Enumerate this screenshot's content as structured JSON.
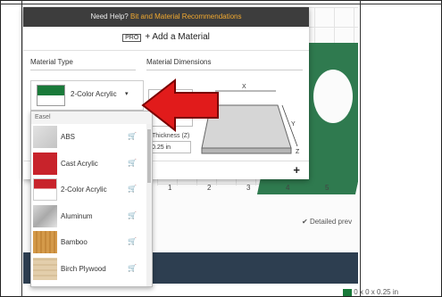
{
  "help_bar": {
    "prefix": "Need Help?",
    "link": "Bit and Material Recommendations"
  },
  "modal": {
    "pro_badge": "PRO",
    "title": "+ Add a Material",
    "material_type_label": "Material Type",
    "material_dimensions_label": "Material Dimensions",
    "selected_material": "2-Color Acrylic",
    "thickness_label": "Thickness (Z)",
    "thickness_value": "0.25 in",
    "diagram_x": "X",
    "diagram_y": "Y",
    "diagram_z": "Z",
    "add_icon": "+"
  },
  "dropdown": {
    "group_header": "Easel",
    "items": [
      {
        "label": "ABS",
        "color": "#d4d4d4"
      },
      {
        "label": "Cast Acrylic",
        "color": "#c8232b"
      },
      {
        "label": "2-Color Acrylic",
        "color": "#c8232b"
      },
      {
        "label": "Aluminum",
        "color": "#c9c9c9"
      },
      {
        "label": "Bamboo",
        "color": "#d49a4a"
      },
      {
        "label": "Birch Plywood",
        "color": "#e0c9a4"
      }
    ]
  },
  "ruler": [
    "1",
    "2",
    "3",
    "4",
    "5"
  ],
  "detailed_preview": "Detailed prev",
  "corner_text": "0 x 0 x 0.25 in",
  "colors": {
    "arrow": "#e11b1b",
    "swatch_green": "#1a7a3a",
    "bottom_bar": "#2d3e50",
    "link": "#f0a830"
  }
}
